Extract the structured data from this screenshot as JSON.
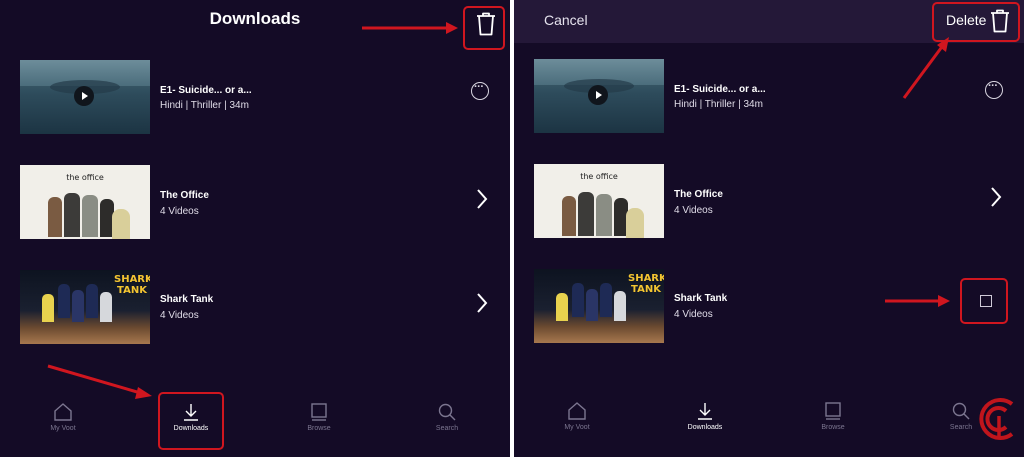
{
  "left": {
    "title": "Downloads",
    "items": [
      {
        "title": "E1- Suicide... or a...",
        "sub": "Hindi | Thriller | 34m"
      },
      {
        "title": "The Office",
        "sub": "4 Videos",
        "thumb_text": "the office"
      },
      {
        "title": "Shark Tank",
        "sub": "4 Videos",
        "thumb_text": "SHARK TANK"
      }
    ],
    "nav": [
      {
        "label": "My Voot",
        "icon": "home-icon"
      },
      {
        "label": "Downloads",
        "icon": "download-icon",
        "active": true
      },
      {
        "label": "Browse",
        "icon": "browse-icon"
      },
      {
        "label": "Search",
        "icon": "search-icon"
      }
    ]
  },
  "right": {
    "cancel": "Cancel",
    "delete": "Delete",
    "items": [
      {
        "title": "E1- Suicide... or a...",
        "sub": "Hindi | Thriller | 34m"
      },
      {
        "title": "The Office",
        "sub": "4 Videos",
        "thumb_text": "the office"
      },
      {
        "title": "Shark Tank",
        "sub": "4 Videos",
        "thumb_text": "SHARK TANK"
      }
    ],
    "nav": [
      {
        "label": "My Voot",
        "icon": "home-icon"
      },
      {
        "label": "Downloads",
        "icon": "download-icon",
        "active": true
      },
      {
        "label": "Browse",
        "icon": "browse-icon"
      },
      {
        "label": "Search",
        "icon": "search-icon"
      }
    ]
  },
  "colors": {
    "background": "#140b26",
    "edit_bar": "#241838",
    "highlight": "#d0161f",
    "nav_inactive": "#7c7690"
  }
}
